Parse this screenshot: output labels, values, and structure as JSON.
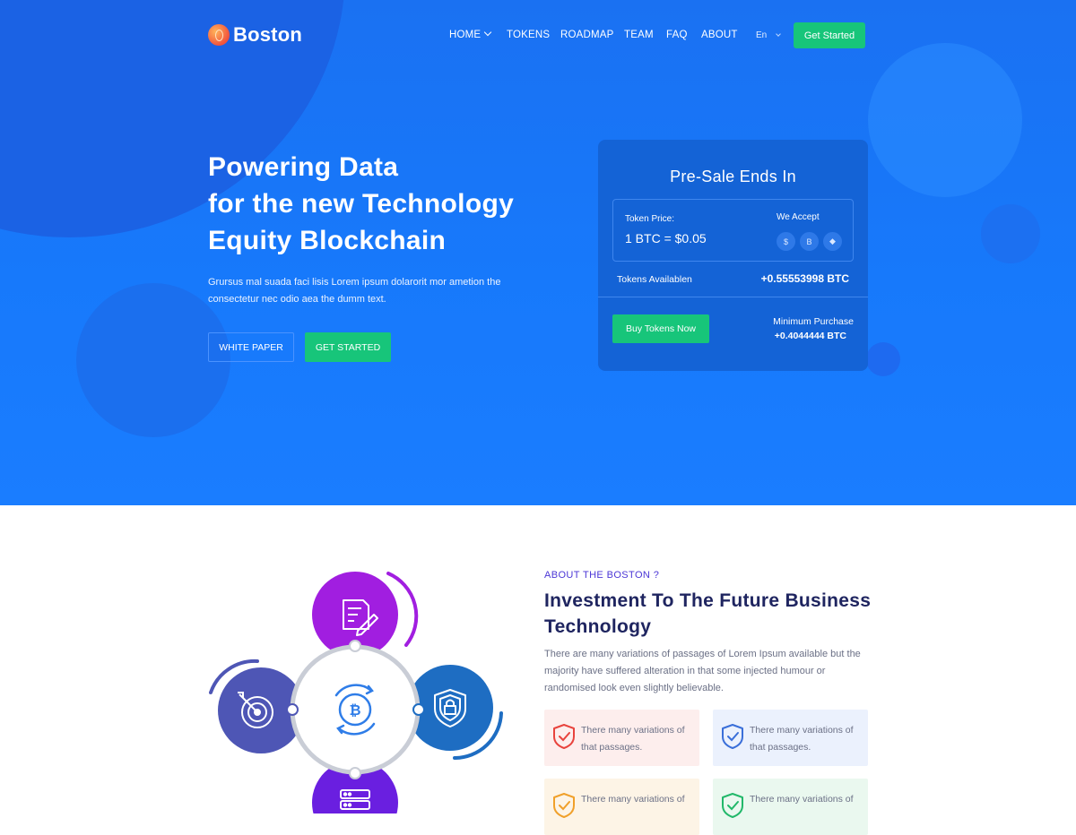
{
  "brand": {
    "name": "Boston"
  },
  "nav": {
    "home": "HOME",
    "tokens": "TOKENS",
    "roadmap": "ROADMAP",
    "team": "TEAM",
    "faq": "FAQ",
    "about": "ABOUT",
    "language": "En",
    "cta": "Get Started"
  },
  "hero": {
    "title_lines": [
      "Powering Data",
      "for the new Technology",
      "Equity Blockchain"
    ],
    "description": "Grursus mal suada faci lisis Lorem ipsum dolarorit mor ametion the consectetur nec odio aea the dumm text.",
    "btn_whitepaper": "WHITE PAPER",
    "btn_start": "GET STARTED"
  },
  "presale": {
    "title": "Pre-Sale Ends In",
    "price_label": "Token Price:",
    "price_value": "1 BTC = $0.05",
    "accept_label": "We Accept",
    "coins": [
      {
        "icon": "dollar-coin-icon",
        "glyph": "$"
      },
      {
        "icon": "bitcoin-coin-icon",
        "glyph": "B"
      },
      {
        "icon": "ethereum-coin-icon",
        "glyph": "◆"
      }
    ],
    "available_label": "Tokens Availablen",
    "available_value": "+0.55553998 BTC",
    "buy_button": "Buy Tokens Now",
    "min_label": "Minimum Purchase",
    "min_value": "+0.4044444 BTC"
  },
  "about": {
    "eyebrow": "ABOUT THE BOSTON ?",
    "title": "Investment To The Future Business Technology",
    "description": "There are many variations of passages of Lorem Ipsum available but the majority have suffered alteration in that some injected humour or randomised look even slightly believable.",
    "features": [
      {
        "text": "There many variations of that passages.",
        "color": "#e8433d"
      },
      {
        "text": "There many variations of that passages.",
        "color": "#3a6fd9"
      },
      {
        "text": "There many variations of",
        "color": "#f0a02a"
      },
      {
        "text": "There many variations of",
        "color": "#22b86a"
      }
    ]
  },
  "diagram": {
    "icons": [
      "document-edit-icon",
      "target-icon",
      "shield-lock-icon",
      "server-icon",
      "bitcoin-refresh-icon"
    ],
    "colors": {
      "top": "#a11ee0",
      "left": "#4e56b5",
      "right": "#1e6dc2",
      "bottom": "#6a1fe0",
      "center_ring": "#c9cdd6",
      "center_icon": "#2f7de8"
    }
  },
  "colors": {
    "hero_bg": "#1779fb",
    "card_bg": "#1463d6",
    "accent_green": "#17c57a",
    "heading_dark": "#1f2560",
    "eyebrow": "#4b36d6"
  }
}
